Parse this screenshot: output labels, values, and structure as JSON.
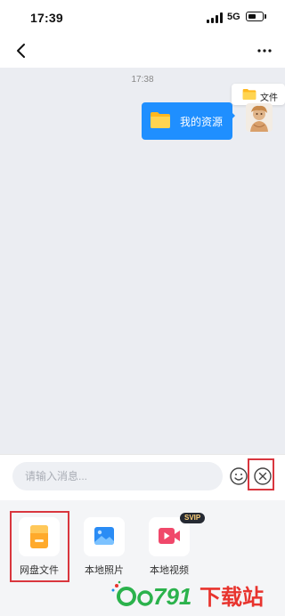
{
  "status_bar": {
    "time": "17:39",
    "network": "5G"
  },
  "chat": {
    "timestamp": "17:38",
    "file_message": {
      "label": "我的资源"
    },
    "file_tooltip": {
      "label": "文件"
    }
  },
  "composer": {
    "placeholder": "请输入消息..."
  },
  "tray": {
    "items": [
      {
        "label": "网盘文件"
      },
      {
        "label": "本地照片"
      },
      {
        "label": "本地视频",
        "badge": "SVIP"
      }
    ]
  },
  "watermark": {
    "text": "Oo791下载站"
  },
  "colors": {
    "bubble_blue": "#1f8fff",
    "chat_background": "#ebedf2",
    "highlight_red": "#d9363e",
    "folder_yellow": "#ffc83d"
  }
}
